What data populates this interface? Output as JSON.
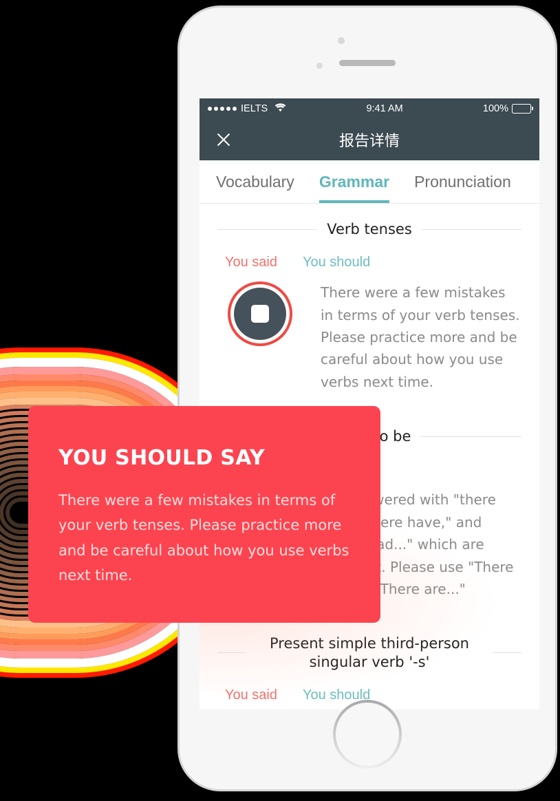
{
  "rings": {
    "colors": [
      "#ff1a00",
      "#ffe800",
      "#ffffff",
      "#ff9a9a",
      "#ff8a6b",
      "#ff7a4a",
      "#ff9c5c",
      "#ffb070",
      "#ffc089"
    ]
  },
  "phone": {
    "speaker": "speaker-grille",
    "camera": "front-camera",
    "sensor": "proximity-sensor",
    "home_button": "home-button"
  },
  "statusbar": {
    "carrier": "IELTS",
    "wifi": "wifi-icon",
    "time": "9:41 AM",
    "battery_percent": "100%"
  },
  "navbar": {
    "close_icon": "close-icon",
    "title": "报告详情"
  },
  "tabs": [
    {
      "label": "Vocabulary",
      "active": false
    },
    {
      "label": "Grammar",
      "active": true
    },
    {
      "label": "Pronunciation",
      "active": false
    }
  ],
  "labels": {
    "you_said": "You said",
    "you_should": "You should"
  },
  "sections": [
    {
      "title": "Verb tenses",
      "body": "There were a few mistakes in terms of your verb tenses. Please practice more and be careful about how you use verbs next time."
    },
    {
      "title": "There to be",
      "body": "You answered with \"there has,\" \"there have,\" and \"there had...\" which are incorrect. Please use \"There is...\" or \"There are...\""
    },
    {
      "title": "Present simple third-person singular verb '-s'",
      "body": ""
    }
  ],
  "card": {
    "title": "YOU SHOULD SAY",
    "body": "There were a few mistakes in terms of your verb tenses. Please practice more and be careful about how you use verbs next time."
  },
  "colors": {
    "card_red": "#fc4450",
    "accent_teal": "#5fb6bb",
    "you_said_red": "#f4716b",
    "navbar_dark": "#3c4a52",
    "record_ring": "#ef4a44"
  }
}
